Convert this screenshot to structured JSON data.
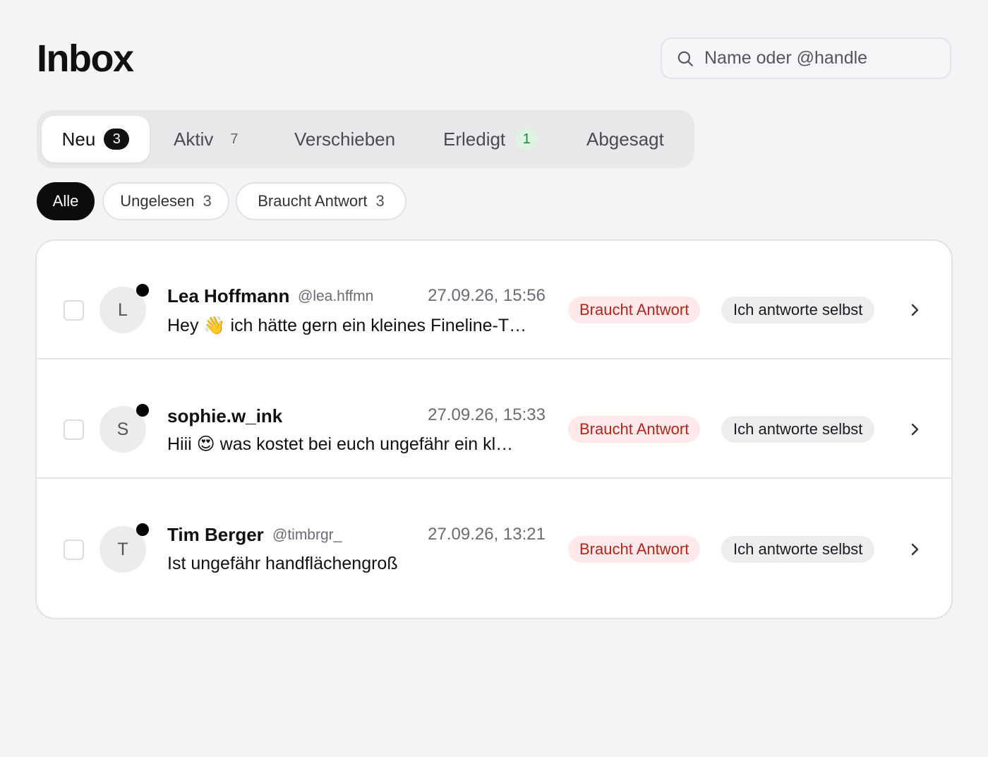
{
  "header": {
    "title": "Inbox",
    "search_placeholder": "Name oder @handle",
    "search_icon": "search-icon"
  },
  "tabs": [
    {
      "label": "Neu",
      "count": "3",
      "active": true
    },
    {
      "label": "Aktiv",
      "count": "7"
    },
    {
      "label": "Verschieben"
    },
    {
      "label": "Erledigt",
      "count": "1"
    },
    {
      "label": "Abgesagt"
    }
  ],
  "filters": [
    {
      "label": "Alle",
      "active": true
    },
    {
      "label": "Ungelesen",
      "count": "3"
    },
    {
      "label": "Braucht Antwort",
      "count": "3"
    }
  ],
  "conversations": [
    {
      "initial": "L",
      "name": "Lea Hoffmann",
      "handle": "@lea.hffmn",
      "time": "27.09.26, 15:56",
      "preview": "Hey 👋  ich hätte gern ein kleines Fineline-T…",
      "status": "Braucht Antwort",
      "action": "Ich antworte selbst",
      "unread": true
    },
    {
      "initial": "S",
      "name": "sophie.w_ink",
      "handle": "",
      "time": "27.09.26, 15:33",
      "preview": "Hiii 😍  was kostet bei euch ungefähr ein kl…",
      "status": "Braucht Antwort",
      "action": "Ich antworte selbst",
      "unread": true
    },
    {
      "initial": "T",
      "name": "Tim Berger",
      "handle": "@timbrgr_",
      "time": "27.09.26, 13:21",
      "preview": "Ist ungefähr handflächengroß",
      "status": "Braucht Antwort",
      "action": "Ich antworte selbst",
      "unread": true
    }
  ],
  "colors": {
    "background": "#f4f4f6",
    "status_red_text": "#b3261e",
    "status_red_bg": "#fde9e9",
    "count_green_text": "#1b8a3c",
    "count_green_bg": "#dff3e4"
  }
}
